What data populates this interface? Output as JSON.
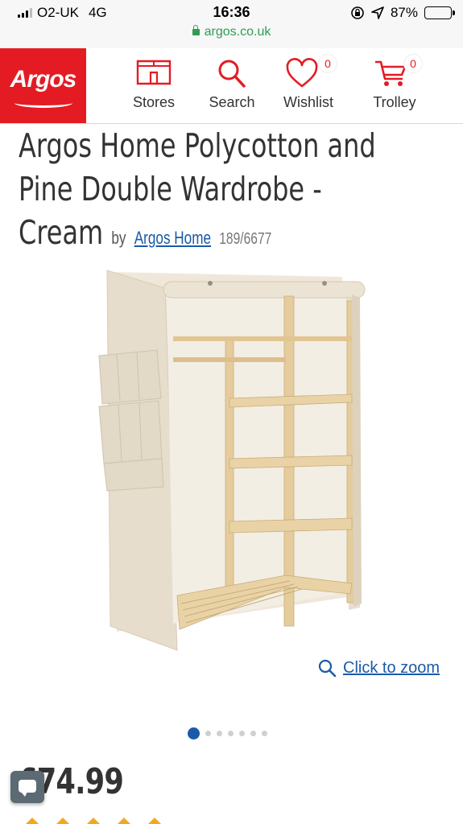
{
  "status_bar": {
    "carrier": "O2-UK",
    "network": "4G",
    "time": "16:36",
    "battery_percent": "87%",
    "battery_level": 0.87,
    "url": "argos.co.uk"
  },
  "header": {
    "logo_text": "Argos",
    "nav": [
      {
        "label": "Stores",
        "icon": "store-icon"
      },
      {
        "label": "Search",
        "icon": "search-icon"
      },
      {
        "label": "Wishlist",
        "icon": "heart-icon",
        "badge": "0"
      },
      {
        "label": "Trolley",
        "icon": "trolley-icon",
        "badge": "0"
      }
    ]
  },
  "product": {
    "title_line1": "Argos Home Polycotton and",
    "title_line2": "Pine Double Wardrobe -",
    "title_line3": "Cream",
    "by": "by",
    "brand": "Argos Home",
    "catalogue_number": "189/6677",
    "zoom_label": "Click to zoom",
    "image_count": 7,
    "active_image": 1,
    "price": "£74.99"
  },
  "colors": {
    "brand_red": "#e41b23",
    "link_blue": "#1a5aa8",
    "secure_green": "#2e9d52"
  }
}
